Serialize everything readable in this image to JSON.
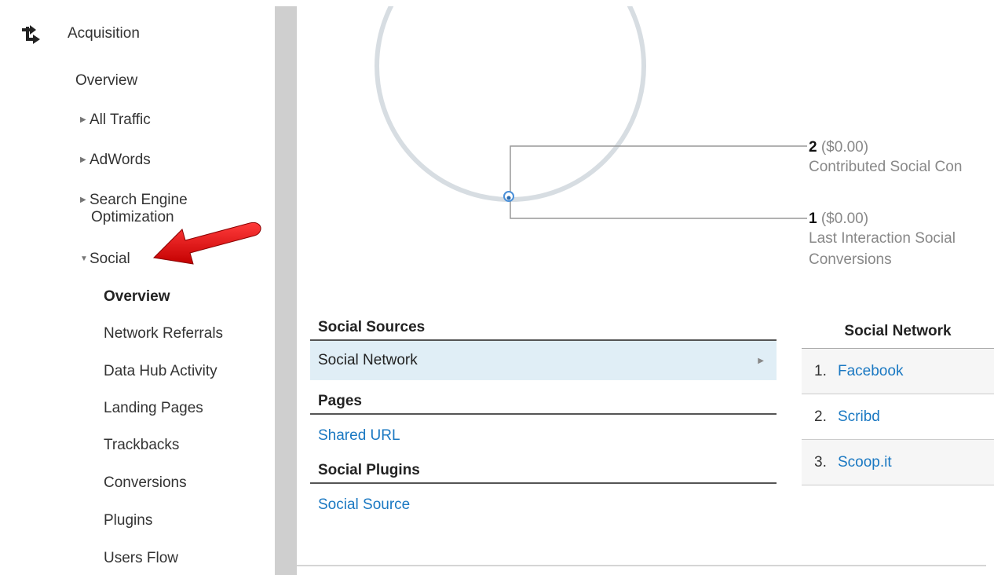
{
  "sidebar": {
    "section": {
      "label": "Acquisition",
      "icon": "acquisition-arrows-icon"
    },
    "items": [
      {
        "label": "Overview",
        "expandable": false
      },
      {
        "label": "All Traffic",
        "expandable": true,
        "expanded": false
      },
      {
        "label": "AdWords",
        "expandable": true,
        "expanded": false
      },
      {
        "label": "Search Engine",
        "label2": "Optimization",
        "expandable": true,
        "expanded": false
      },
      {
        "label": "Social",
        "expandable": true,
        "expanded": true
      }
    ],
    "social_items": [
      {
        "label": "Overview",
        "selected": true
      },
      {
        "label": "Network Referrals"
      },
      {
        "label": "Data Hub Activity"
      },
      {
        "label": "Landing Pages"
      },
      {
        "label": "Trackbacks"
      },
      {
        "label": "Conversions"
      },
      {
        "label": "Plugins"
      },
      {
        "label": "Users Flow"
      }
    ],
    "annotation": {
      "icon": "red-arrow-icon",
      "color": "#e02020"
    }
  },
  "conversions": {
    "contributed": {
      "count": "2",
      "value": "($0.00)",
      "label": "Contributed Social Con"
    },
    "last_interaction": {
      "count": "1",
      "value": "($0.00)",
      "label_line1": "Last Interaction Social",
      "label_line2": "Conversions"
    }
  },
  "sources": {
    "social_sources": {
      "header": "Social Sources",
      "selected_row": "Social Network"
    },
    "pages": {
      "header": "Pages",
      "link": "Shared URL"
    },
    "social_plugins": {
      "header": "Social Plugins",
      "link": "Social Source"
    }
  },
  "network_table": {
    "header": "Social Network",
    "rows": [
      {
        "index": "1.",
        "name": "Facebook"
      },
      {
        "index": "2.",
        "name": "Scribd"
      },
      {
        "index": "3.",
        "name": "Scoop.it"
      }
    ]
  },
  "colors": {
    "link": "#1a78c2",
    "selected_row_bg": "#e0eef6",
    "circle": "#d7dde2",
    "scrollbar": "#cfcfcf"
  }
}
